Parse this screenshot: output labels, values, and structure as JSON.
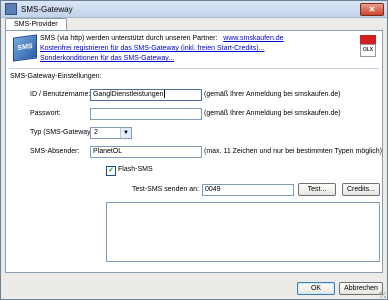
{
  "window": {
    "title": "SMS-Gateway",
    "close_glyph": "✕"
  },
  "tabs": [
    {
      "label": "SMS-Provider"
    }
  ],
  "header": {
    "logo_text": "SMS",
    "intro_text": "SMS (via http) werden unterstützt durch unseren Partner:",
    "partner_link": "www.smskaufen.de",
    "register_link": "Kostenfrei registrieren für das SMS-Gateway (inkl. freien Start-Credits)...",
    "terms_link": "Sonderkonditionen für das SMS-Gateway...",
    "brand_text": "OLX"
  },
  "settings": {
    "section_label": "SMS-Gateway-Einstellungen:",
    "id_label": "ID / Benutzername:",
    "id_value": "GanglDienstleistungen",
    "id_hint": "(gemäß Ihrer Anmeldung bei smskaufen.de)",
    "password_label": "Passwort:",
    "password_value": "",
    "password_hint": "(gemäß Ihrer Anmeldung bei smskaufen.de)",
    "type_label": "Typ (SMS-Gateway):",
    "type_value": "2",
    "sender_label": "SMS-Absender:",
    "sender_value": "PlanetOL",
    "sender_hint": "(max. 11 Zeichen und nur bei bestimmten Typen möglich)",
    "flash_label": "Flash-SMS",
    "flash_checked": true,
    "test_label": "Test-SMS senden an:",
    "test_value": "0049",
    "test_button": "Test...",
    "credits_button": "Credits..."
  },
  "footer": {
    "ok_button": "OK",
    "cancel_button": "Abbrechen"
  },
  "icons": {
    "dropdown": "▼",
    "check": "✓"
  }
}
